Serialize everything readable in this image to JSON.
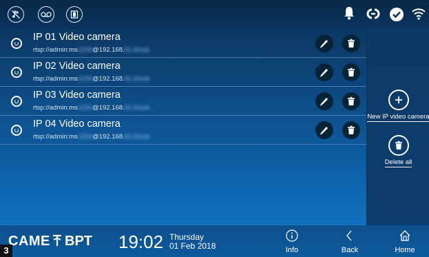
{
  "status_bar": {
    "left_icons": [
      "music-note-off-icon",
      "voicemail-icon",
      "door-open-icon"
    ],
    "right_icons": [
      "bell-icon",
      "link-icon",
      "check-circle-icon",
      "wifi-icon"
    ]
  },
  "cameras": [
    {
      "title": "IP 01 Video camera",
      "url_prefix": "rtsp://admin:ms",
      "url_blur1": "1234",
      "url_mid": "@192.168.",
      "url_blur2": "61.6/sub"
    },
    {
      "title": "IP 02 Video camera",
      "url_prefix": "rtsp://admin:ms",
      "url_blur1": "1234",
      "url_mid": "@192.168.",
      "url_blur2": "61.6/sub"
    },
    {
      "title": "IP 03 Video camera",
      "url_prefix": "rtsp://admin:ms",
      "url_blur1": "1234",
      "url_mid": "@192.168.",
      "url_blur2": "61.6/sub"
    },
    {
      "title": "IP 04 Video camera",
      "url_prefix": "rtsp://admin:ms",
      "url_blur1": "1234",
      "url_mid": "@192.168.",
      "url_blur2": "61.6/sub"
    }
  ],
  "right_panel": {
    "new_label": "New IP video camera",
    "delete_all_label": "Delete all"
  },
  "bottom_bar": {
    "brand_came": "CAME",
    "brand_bpt": "BPT",
    "time": "19:02",
    "day": "Thursday",
    "date": "01 Feb 2018",
    "info_label": "Info",
    "back_label": "Back",
    "home_label": "Home"
  },
  "figure_number": "3",
  "colors": {
    "background_top": "#0a2f55",
    "background_bottom": "#1179c8",
    "row_button": "#072338",
    "text": "#ffffff"
  }
}
